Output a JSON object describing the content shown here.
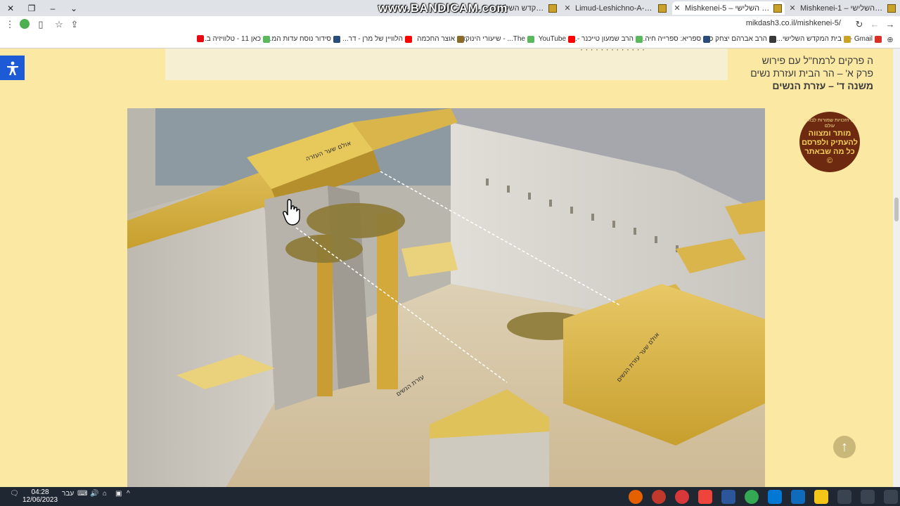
{
  "browser": {
    "tabs": [
      {
        "title": "Mishkenei-1 – בית המקדש השלישי",
        "active": false
      },
      {
        "title": "Mishkenei-5 – בית המקדש השלישי",
        "active": true
      },
      {
        "title": "Limud-Leshichno-A-2 – בית המקדש השלישי",
        "active": false
      },
      {
        "title": "בית המקדש השלישי",
        "active": false
      }
    ],
    "watermark": "www.BANDICAM.com",
    "url": "mikdash3.co.il/mishkenei-5/",
    "icons": {
      "back": "back-arrow-icon",
      "forward": "forward-arrow-icon",
      "reload": "reload-icon"
    }
  },
  "bookmarks": [
    {
      "label": "Gmail -",
      "color": "#d93025"
    },
    {
      "label": "בית המקדש השלישי...",
      "color": "#c9a227"
    },
    {
      "label": "הרב אברהם יצחק כ...",
      "color": "#3a3a3a"
    },
    {
      "label": "ספריא: ספרייה חיה...",
      "color": "#2b4b7b"
    },
    {
      "label": "הרב שמעון טייכנר -...",
      "color": "#5cb85c"
    },
    {
      "label": "YouTube",
      "color": "#ff0000"
    },
    {
      "label": "The... - שיעורי הינוקא",
      "color": "#5cb85c"
    },
    {
      "label": "אוצר החכמה",
      "color": "#8b6b2b"
    },
    {
      "label": "הלוויין של מרן - דר...",
      "color": "#ff0000"
    },
    {
      "label": "סידור נוסח עדות המ...",
      "color": "#2b4b7b"
    },
    {
      "label": "כאן 11 - טלוויזיה ב...",
      "color": "#5cb85c"
    },
    {
      "label": "",
      "color": "#e50914"
    }
  ],
  "page": {
    "breadcrumb_1": "ה פרקים לרמח\"ל עם פירוש",
    "breadcrumb_2": "פרק א' – הר הבית ועזרת נשים",
    "breadcrumb_3": "משנה ד' – עזרת הנשים",
    "badge_small": "כל הזכויות שמורות לבורא עולם",
    "badge_line1": "מותר ומצווה",
    "badge_line2": "להעתיק ולפרסם",
    "badge_line3": "כל מה שבאתר",
    "badge_copy": "©",
    "scene_label_1": "אולם שער העזרה",
    "scene_label_2": "עזרת הנשים",
    "scene_label_3": "אולם שער עזרת הנשים"
  },
  "taskbar": {
    "time": "04:28",
    "date": "12/06/2023",
    "lang": "עבר",
    "apps": [
      {
        "name": "firefox-icon",
        "color": "#e66000"
      },
      {
        "name": "record-icon",
        "color": "#c0392b"
      },
      {
        "name": "opera-icon",
        "color": "#d9383a"
      },
      {
        "name": "anydesk-icon",
        "color": "#ef443b"
      },
      {
        "name": "word-icon",
        "color": "#2b579a"
      },
      {
        "name": "chrome-icon",
        "color": "#34a853"
      },
      {
        "name": "mail-icon",
        "color": "#0078d4"
      },
      {
        "name": "store-icon",
        "color": "#0f6cbd"
      },
      {
        "name": "explorer-icon",
        "color": "#f5c518"
      },
      {
        "name": "taskview-icon",
        "color": "#cfcfcf"
      },
      {
        "name": "search-icon",
        "color": "#ffffff"
      },
      {
        "name": "start-icon",
        "color": "#ffffff"
      }
    ]
  }
}
